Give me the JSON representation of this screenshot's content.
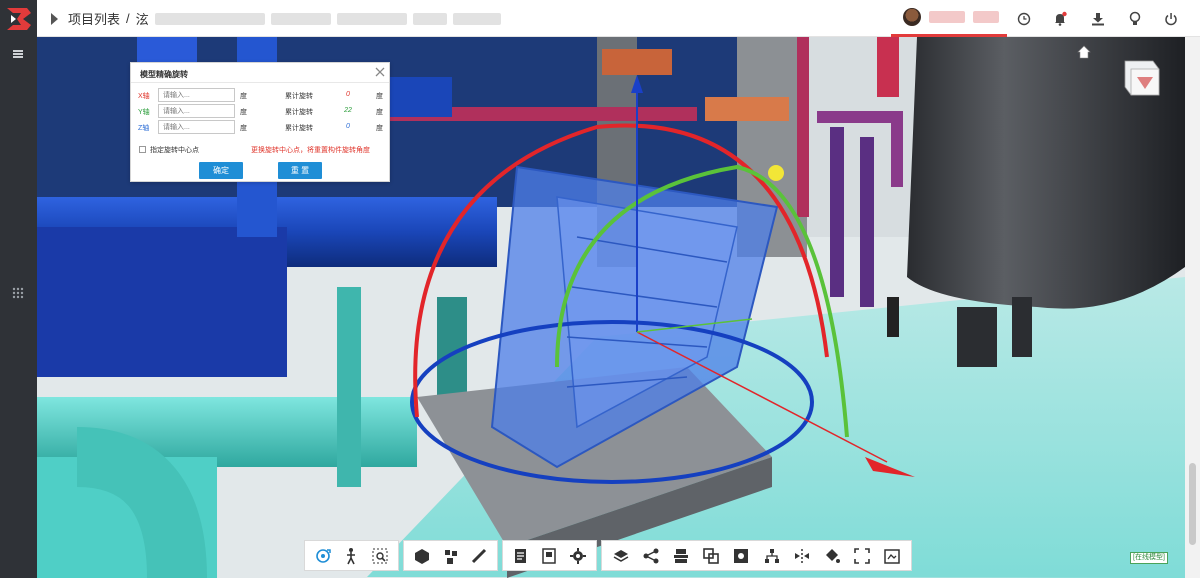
{
  "app": {
    "logo_icon": "bimface-logo-icon",
    "brand_color": "#e23b3b"
  },
  "rail": {
    "items": [
      {
        "icon": "menu-icon"
      },
      {
        "icon": "grid-dots-icon"
      }
    ]
  },
  "header": {
    "breadcrumb": {
      "root": "项目列表",
      "separator": "/",
      "current_prefix": "泫"
    },
    "user": {
      "icon": "avatar"
    },
    "actions": [
      {
        "icon": "clock-icon"
      },
      {
        "icon": "bell-icon",
        "badge_color": "#e23b3b"
      },
      {
        "icon": "download-icon"
      },
      {
        "icon": "lightbulb-icon"
      },
      {
        "icon": "power-icon"
      }
    ]
  },
  "viewport": {
    "home_icon": "home-icon",
    "viewcube_icon": "viewcube-icon"
  },
  "dialog": {
    "title": "模型精确旋转",
    "close_icon": "close-icon",
    "input_placeholder": "请输入...",
    "unit": "度",
    "accum_label": "累计旋转",
    "rows": [
      {
        "axis": "X轴",
        "color": "#e0362c",
        "accum": "0"
      },
      {
        "axis": "Y轴",
        "color": "#2a9d3a",
        "accum": "22"
      },
      {
        "axis": "Z轴",
        "color": "#2f6fd6",
        "accum": "0"
      }
    ],
    "checkbox_label": "指定旋转中心点",
    "warning": "更换旋转中心点，将重置构件旋转角度",
    "confirm": "确定",
    "reset": "重 置"
  },
  "toolbar": {
    "groups": [
      [
        "orbit-icon",
        "walk-icon",
        "zoom-box-icon"
      ],
      [
        "component-icon",
        "explode-icon",
        "measure-icon"
      ],
      [
        "properties-icon",
        "info-icon",
        "settings-icon"
      ],
      [
        "layers-icon",
        "share-icon",
        "stack-icon",
        "section-box-icon",
        "isolate-icon",
        "tree-icon",
        "split-icon",
        "paint-icon",
        "fullscreen-icon",
        "snapshot-icon"
      ]
    ]
  },
  "status": {
    "online_label": "[在线模型]"
  }
}
